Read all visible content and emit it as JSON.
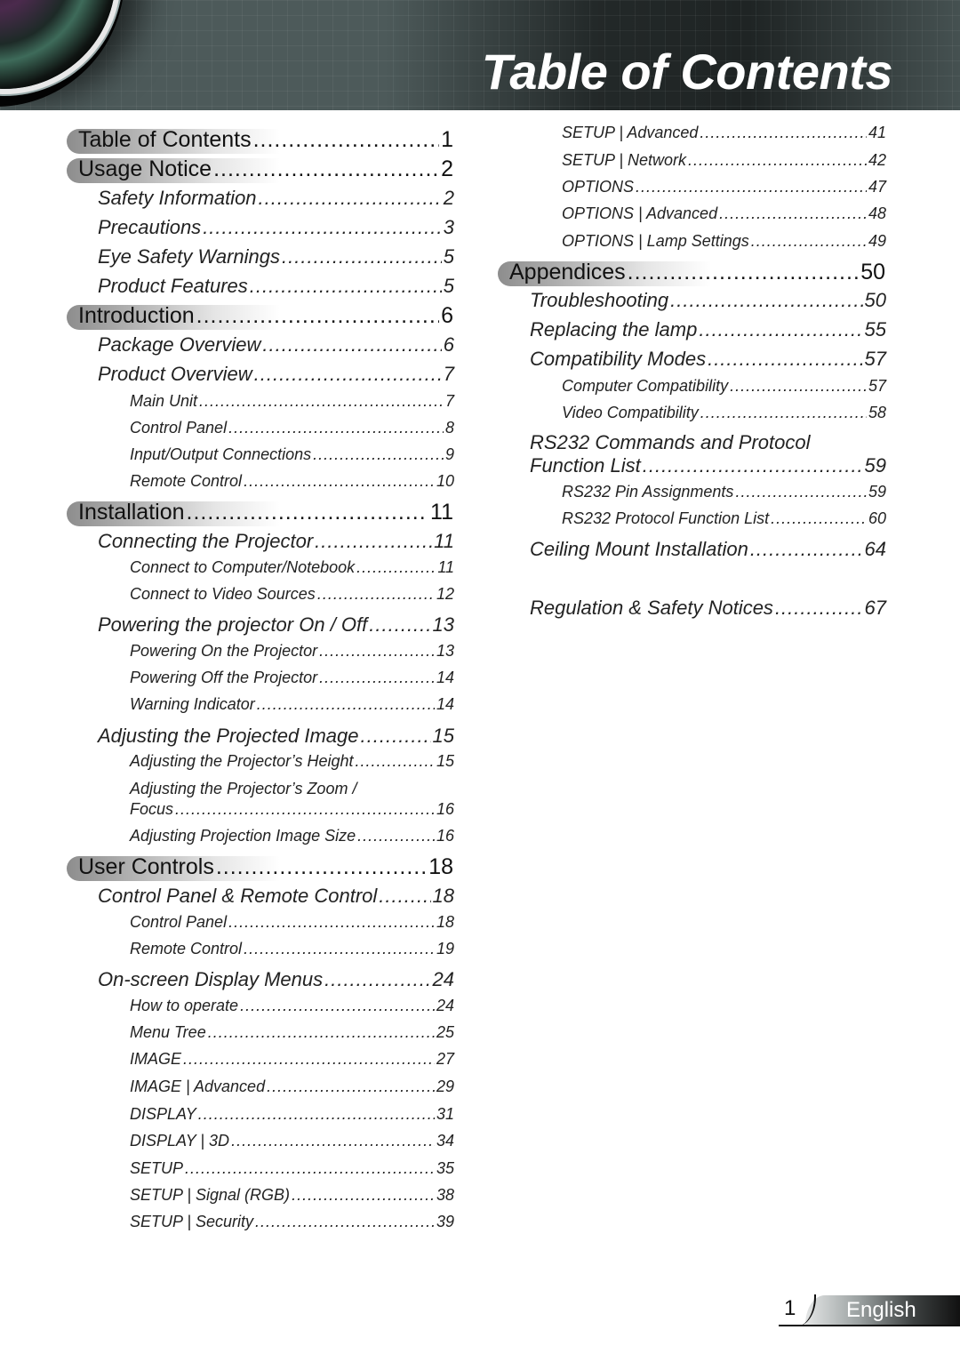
{
  "header": {
    "title": "Table of Contents"
  },
  "toc": {
    "left": [
      {
        "level": 1,
        "label": "Table of Contents",
        "page": "1"
      },
      {
        "level": 1,
        "label": "Usage Notice",
        "page": "2"
      },
      {
        "level": 2,
        "label": "Safety Information",
        "page": "2"
      },
      {
        "level": 2,
        "label": "Precautions",
        "page": "3"
      },
      {
        "level": 2,
        "label": "Eye Safety Warnings",
        "page": "5"
      },
      {
        "level": 2,
        "label": "Product Features",
        "page": "5"
      },
      {
        "level": 1,
        "label": "Introduction",
        "page": "6"
      },
      {
        "level": 2,
        "label": "Package Overview",
        "page": "6"
      },
      {
        "level": 2,
        "label": "Product Overview",
        "page": "7"
      },
      {
        "level": 3,
        "label": "Main Unit",
        "page": "7"
      },
      {
        "level": 3,
        "label": "Control Panel",
        "page": "8"
      },
      {
        "level": 3,
        "label": "Input/Output Connections",
        "page": "9"
      },
      {
        "level": 3,
        "label": "Remote Control",
        "page": "10"
      },
      {
        "level": 1,
        "label": "Installation",
        "page": "11"
      },
      {
        "level": 2,
        "label": "Connecting the Projector",
        "page": "11"
      },
      {
        "level": 3,
        "label": "Connect to Computer/Notebook",
        "page": "11"
      },
      {
        "level": 3,
        "label": "Connect to Video Sources",
        "page": "12"
      },
      {
        "level": 2,
        "label": "Powering the projector On / Off",
        "page": "13"
      },
      {
        "level": 3,
        "label": "Powering On the Projector",
        "page": "13"
      },
      {
        "level": 3,
        "label": "Powering Off the Projector",
        "page": "14"
      },
      {
        "level": 3,
        "label": "Warning Indicator",
        "page": "14"
      },
      {
        "level": 2,
        "label": "Adjusting the Projected Image",
        "page": "15"
      },
      {
        "level": 3,
        "label": "Adjusting the Projector’s Height",
        "page": "15"
      },
      {
        "level": 3,
        "label": "Adjusting the Projector’s Zoom /",
        "label2": "Focus",
        "page": "16"
      },
      {
        "level": 3,
        "label": "Adjusting Projection Image Size",
        "page": "16"
      },
      {
        "level": 1,
        "label": "User Controls",
        "page": "18"
      },
      {
        "level": 2,
        "label": "Control Panel & Remote Control",
        "page": "18"
      },
      {
        "level": 3,
        "label": "Control Panel",
        "page": "18"
      },
      {
        "level": 3,
        "label": "Remote Control",
        "page": "19"
      },
      {
        "level": 2,
        "label": "On-screen Display Menus",
        "page": "24"
      },
      {
        "level": 3,
        "label": "How to operate ",
        "page": "24"
      },
      {
        "level": 3,
        "label": "Menu Tree",
        "page": "25"
      },
      {
        "level": 3,
        "label": "IMAGE ",
        "page": "27"
      },
      {
        "level": 3,
        "label": "IMAGE | Advanced ",
        "page": "29"
      },
      {
        "level": 3,
        "label": "DISPLAY",
        "page": "31"
      },
      {
        "level": 3,
        "label": "DISPLAY | 3D ",
        "page": "34"
      },
      {
        "level": 3,
        "label": "SETUP",
        "page": "35"
      },
      {
        "level": 3,
        "label": "SETUP | Signal (RGB)",
        "page": "38"
      },
      {
        "level": 3,
        "label": "SETUP | Security",
        "page": "39"
      }
    ],
    "right": [
      {
        "level": 3,
        "label": "SETUP | Advanced ",
        "page": "41"
      },
      {
        "level": 3,
        "label": "SETUP | Network",
        "page": "42"
      },
      {
        "level": 3,
        "label": "OPTIONS",
        "page": "47"
      },
      {
        "level": 3,
        "label": "OPTIONS | Advanced",
        "page": "48"
      },
      {
        "level": 3,
        "label": "OPTIONS | Lamp Settings",
        "page": "49"
      },
      {
        "level": 1,
        "label": "Appendices",
        "page": "50"
      },
      {
        "level": 2,
        "label": "Troubleshooting ",
        "page": "50"
      },
      {
        "level": 2,
        "label": "Replacing the lamp",
        "page": "55"
      },
      {
        "level": 2,
        "label": "Compatibility Modes ",
        "page": "57"
      },
      {
        "level": 3,
        "label": "Computer Compatibility ",
        "page": "57"
      },
      {
        "level": 3,
        "label": "Video Compatibility",
        "page": "58"
      },
      {
        "level": 2,
        "label": "RS232 Commands and Protocol",
        "label2": "Function List ",
        "page": "59"
      },
      {
        "level": 3,
        "label": "RS232 Pin Assignments",
        "page": "59"
      },
      {
        "level": 3,
        "label": "RS232 Protocol Function List",
        "page": "60"
      },
      {
        "level": 2,
        "label": "Ceiling Mount Installation",
        "page": "64"
      },
      {
        "level": 2,
        "label": "Regulation & Safety Notices",
        "page": "67"
      }
    ]
  },
  "footer": {
    "page_number": "1",
    "language": "English"
  }
}
